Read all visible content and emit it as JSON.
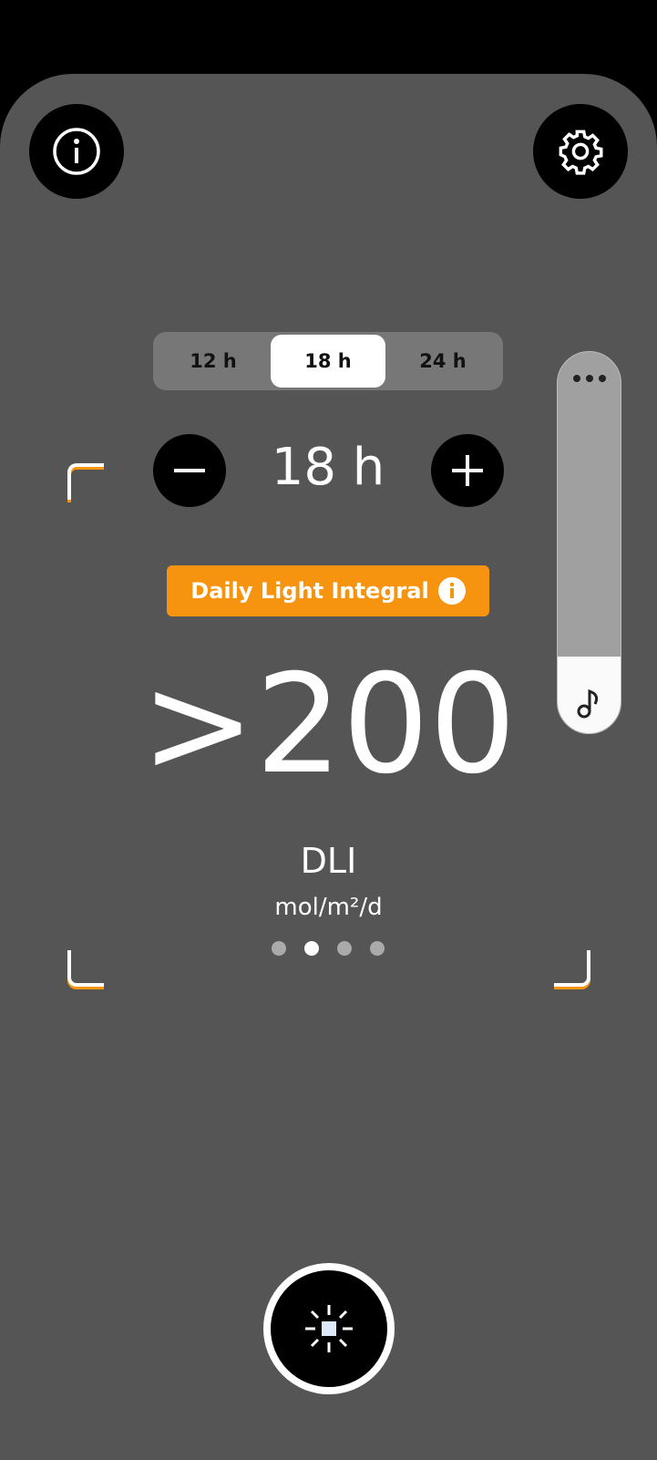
{
  "header": {
    "info_icon": "info-icon",
    "settings_icon": "gear-icon"
  },
  "photoperiod": {
    "options": [
      "12 h",
      "18 h",
      "24 h"
    ],
    "selected": "18 h",
    "value": "18 h"
  },
  "badge": {
    "label": "Daily Light Integral"
  },
  "reading": {
    "value": ">200",
    "unit_name": "DLI",
    "unit": "mol/m²/d"
  },
  "pager": {
    "count": 4,
    "active": 1
  },
  "slider": {
    "level_percent": 20,
    "icon": "music-note-icon",
    "menu_icon": "more-icon"
  },
  "colors": {
    "accent": "#f7940f",
    "background": "#555555"
  }
}
